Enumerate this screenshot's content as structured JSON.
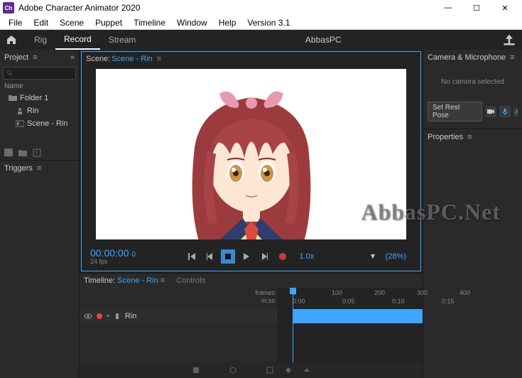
{
  "window": {
    "app_icon": "Ch",
    "title": "Adobe Character Animator 2020",
    "min": "—",
    "max": "☐",
    "close": "✕"
  },
  "menubar": [
    "File",
    "Edit",
    "Scene",
    "Puppet",
    "Timeline",
    "Window",
    "Help",
    "Version 3.1"
  ],
  "tabs": {
    "rig": "Rig",
    "record": "Record",
    "stream": "Stream",
    "center_text": "AbbasPC"
  },
  "project": {
    "title": "Project",
    "name_col": "Name",
    "items": [
      {
        "label": "Folder 1",
        "icon": "folder"
      },
      {
        "label": "Rin",
        "icon": "puppet"
      },
      {
        "label": "Scene - Rin",
        "icon": "scene"
      }
    ]
  },
  "triggers": {
    "title": "Triggers"
  },
  "scene": {
    "label": "Scene:",
    "value": "Scene - Rin",
    "timecode": "00:00:00",
    "timecode_sub": "0",
    "fps": "24 fps",
    "speed": "1.0x",
    "zoom": "(28%)"
  },
  "camera": {
    "title": "Camera & Microphone",
    "empty": "No camera selected",
    "rest_pose": "Set Rest Pose",
    "audio_level": "Audio Level Too Lo"
  },
  "properties": {
    "title": "Properties"
  },
  "timeline": {
    "title_prefix": "Timeline:",
    "title_scene": "Scene - Rin",
    "controls": "Controls",
    "ruler_units1": "frames",
    "ruler_units2": "m:ss",
    "frame_ticks": [
      "0",
      "100",
      "200",
      "300",
      "400"
    ],
    "time_ticks": [
      "0:00",
      "0:05",
      "0:10",
      "0:15"
    ],
    "track_name": "Rin"
  },
  "watermark": "AbbasPC.Net"
}
